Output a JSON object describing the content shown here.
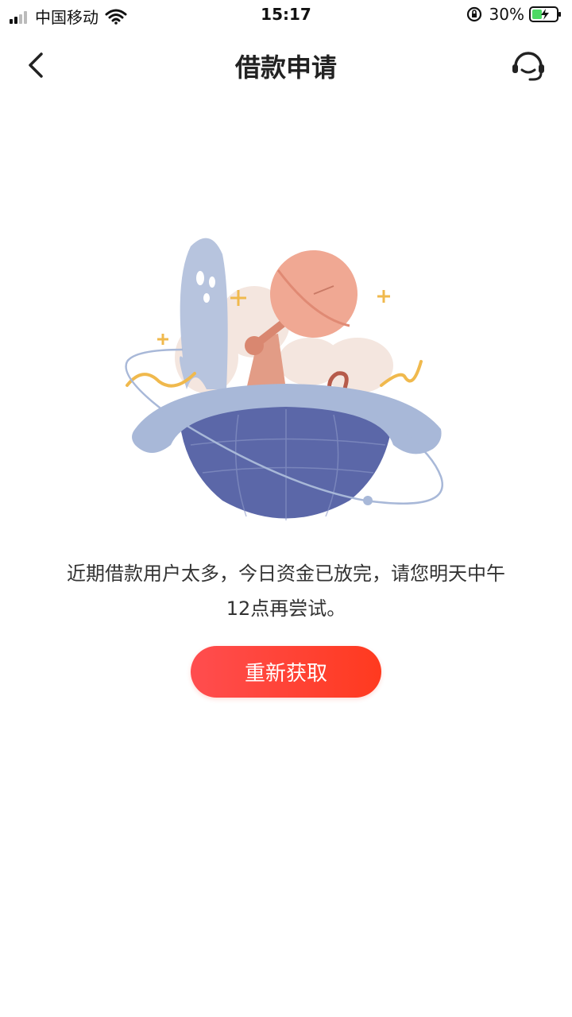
{
  "status_bar": {
    "carrier": "中国移动",
    "time": "15:17",
    "battery_percent": "30%"
  },
  "nav": {
    "title": "借款申请",
    "back_icon": "chevron-left-icon",
    "service_icon": "headset-icon"
  },
  "main": {
    "illustration": "globe-satellite-illustration",
    "message_line1": "近期借款用户太多，今日资金已放完，请您明天中午",
    "message_line2": "12点再尝试。",
    "retry_label": "重新获取"
  },
  "colors": {
    "accent_start": "#ff4d4f",
    "accent_end": "#ff3a1f",
    "globe": "#5b67a8",
    "ring": "#a8b8d8"
  }
}
